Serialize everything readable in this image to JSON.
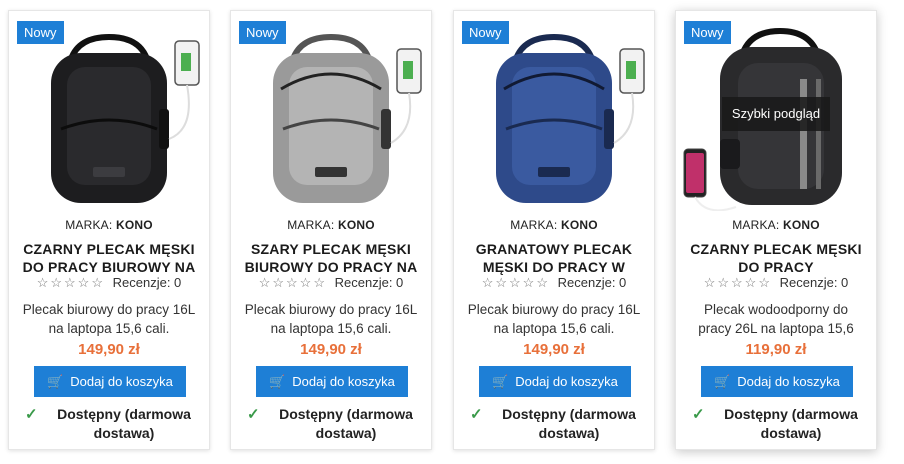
{
  "products": [
    {
      "badge": "Nowy",
      "brand_label": "MARKA:",
      "brand": "KONO",
      "title": "CZARNY PLECAK MĘSKI DO PRACY BIUROWY NA",
      "reviews": "Recenzje: 0",
      "description": "Plecak biurowy do pracy 16L na laptopa 15,6 cali.",
      "price": "149,90 zł",
      "button": "Dodaj do koszyka",
      "availability": "Dostępny (darmowa dostawa)",
      "color": "#1d1d1f"
    },
    {
      "badge": "Nowy",
      "brand_label": "MARKA:",
      "brand": "KONO",
      "title": "SZARY PLECAK MĘSKI BIUROWY DO PRACY NA",
      "reviews": "Recenzje: 0",
      "description": "Plecak biurowy do pracy 16L na laptopa 15,6 cali.",
      "price": "149,90 zł",
      "button": "Dodaj do koszyka",
      "availability": "Dostępny (darmowa dostawa)",
      "color": "#9a9a9a"
    },
    {
      "badge": "Nowy",
      "brand_label": "MARKA:",
      "brand": "KONO",
      "title": "GRANATOWY PLECAK MĘSKI DO PRACY W",
      "reviews": "Recenzje: 0",
      "description": "Plecak biurowy do pracy 16L na laptopa 15,6 cali.",
      "price": "149,90 zł",
      "button": "Dodaj do koszyka",
      "availability": "Dostępny (darmowa dostawa)",
      "color": "#2e4a8a"
    },
    {
      "badge": "Nowy",
      "brand_label": "MARKA:",
      "brand": "KONO",
      "title": "CZARNY PLECAK MĘSKI DO PRACY WODOODPORNY",
      "reviews": "Recenzje: 0",
      "description": "Plecak wodoodporny do pracy 26L na laptopa 15,6",
      "price": "119,90 zł",
      "button": "Dodaj do koszyka",
      "availability": "Dostępny (darmowa dostawa)",
      "quick_view": "Szybki podgląd",
      "color": "#2a2a2c"
    }
  ],
  "colors": {
    "accent": "#1e7fd6",
    "price": "#e8703a",
    "check": "#3a9a4a"
  }
}
